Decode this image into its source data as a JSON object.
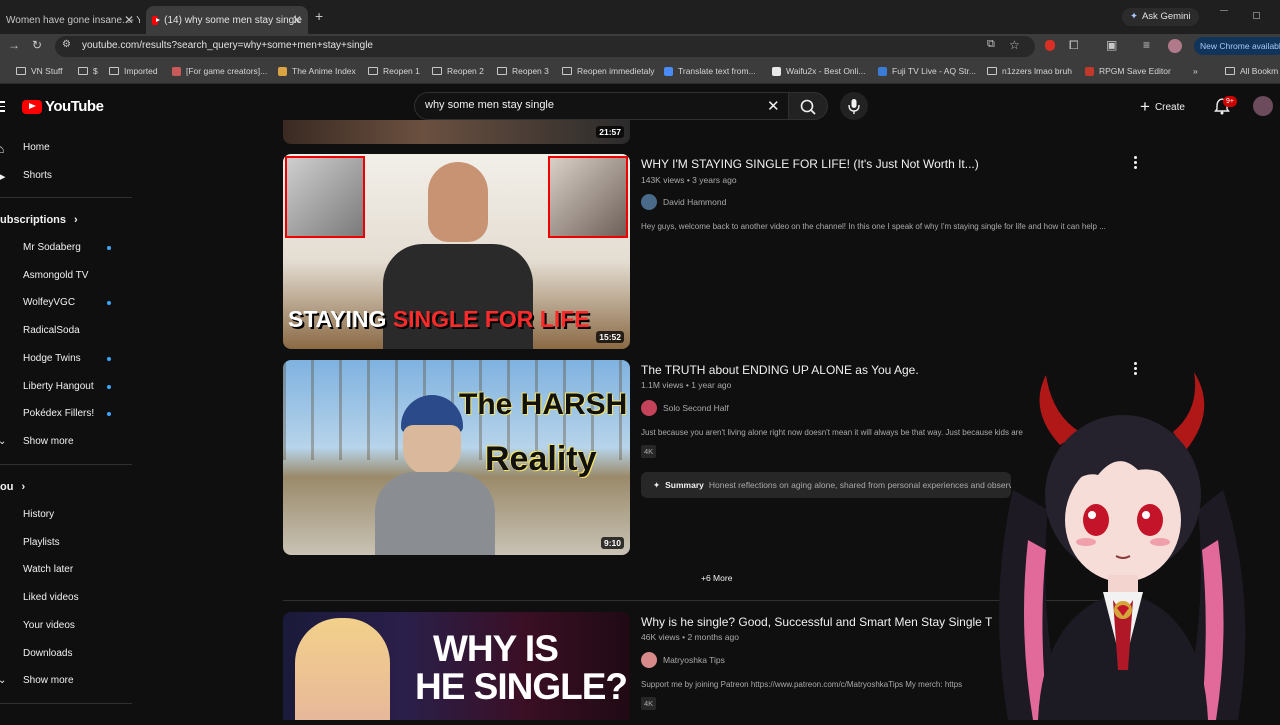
{
  "tabs": [
    {
      "title": "Women have gone insane...- Yo"
    },
    {
      "title": "(14) why some men stay single"
    }
  ],
  "ask_gemini": "Ask Gemini",
  "address": {
    "url": "youtube.com/results?search_query=why+some+men+stay+single"
  },
  "new_chrome": "New Chrome available",
  "bookmarks": [
    "VN Stuff",
    "$",
    "Imported",
    "[For game creators]...",
    "The Anime Index",
    "Reopen 1",
    "Reopen 2",
    "Reopen 3",
    "Reopen immedietaly",
    "Translate text from...",
    "Waifu2x - Best Onli...",
    "Fuji TV Live - AQ Str...",
    "n1zzers lmao bruh",
    "RPGM Save Editor",
    "All Bookm"
  ],
  "youtube": {
    "logo": "YouTube",
    "search_value": "why some men stay single",
    "create": "Create",
    "notif_count": "9+"
  },
  "sidebar": {
    "home": "Home",
    "shorts": "Shorts",
    "subscriptions": "ubscriptions",
    "subs": [
      "Mr Sodaberg",
      "Asmongold TV",
      "WolfeyVGC",
      "RadicalSoda",
      "Hodge Twins",
      "Liberty Hangout",
      "Pokédex Fillers!"
    ],
    "show_more": "Show more",
    "you": "ou",
    "you_items": [
      "History",
      "Playlists",
      "Watch later",
      "Liked videos",
      "Your videos",
      "Downloads"
    ],
    "show_more2": "Show more"
  },
  "results": [
    {
      "duration": "21:57"
    },
    {
      "title": "WHY I'M STAYING SINGLE FOR LIFE! (It's Just Not Worth It...)",
      "meta": "143K views • 3 years ago",
      "channel": "David Hammond",
      "desc": "Hey guys, welcome back to another video on the channel! In this one I speak of why I'm staying single for life and how it can help ...",
      "duration": "15:52",
      "thumb_text_a": "STAYING ",
      "thumb_text_b": "SINGLE FOR LIFE"
    },
    {
      "title": "The TRUTH about ENDING UP ALONE as You Age.",
      "meta": "1.1M views • 1 year ago",
      "channel": "Solo Second Half",
      "desc": "Just because you aren't living alone right now doesn't mean it will always be that way. Just because kids are",
      "badge": "4K",
      "summary_label": "Summary",
      "summary_text": "Honest reflections on aging alone, shared from personal experiences and observa",
      "duration": "9:10",
      "thumb_text_a": "The HARSH",
      "thumb_text_b": "Reality"
    },
    {
      "title": "Why is he single? Good, Successful and Smart Men Stay Single T",
      "meta": "46K views • 2 months ago",
      "channel": "Matryoshka Tips",
      "desc": "Support me by joining Patreon https://www.patreon.com/c/MatryoshkaTips My merch: https",
      "badge": "4K",
      "thumb_text_a": "WHY IS",
      "thumb_text_b": "HE SINGLE?"
    }
  ],
  "more_label": "+6 More"
}
